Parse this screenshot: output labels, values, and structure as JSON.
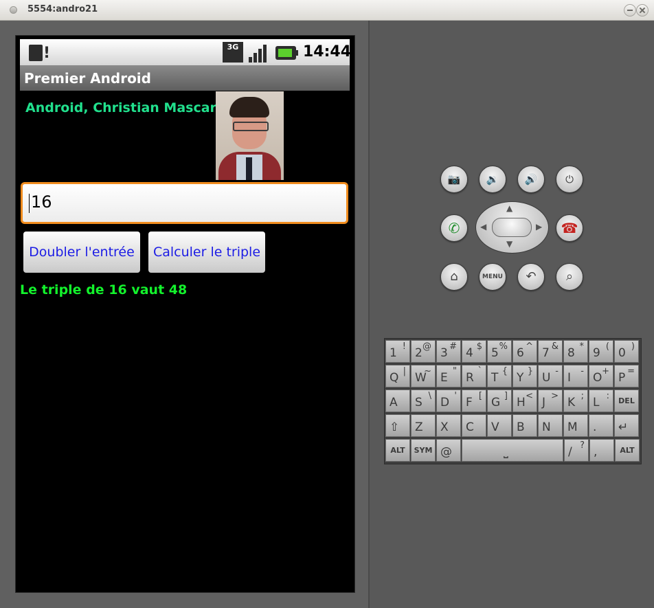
{
  "window": {
    "title": "5554:andro21"
  },
  "status_bar": {
    "time": "14:44",
    "network": "3G"
  },
  "app": {
    "title": "Premier Android",
    "author_label": "Android, Christian Mascart",
    "input_value": "16",
    "button_double": "Doubler l'entrée",
    "button_triple": "Calculer le triple",
    "result_text": "Le triple de 16 vaut 48"
  },
  "controls": {
    "menu_label": "MENU"
  },
  "keyboard": {
    "rows": [
      [
        {
          "m": "1",
          "s": "!"
        },
        {
          "m": "2",
          "s": "@"
        },
        {
          "m": "3",
          "s": "#"
        },
        {
          "m": "4",
          "s": "$"
        },
        {
          "m": "5",
          "s": "%"
        },
        {
          "m": "6",
          "s": "^"
        },
        {
          "m": "7",
          "s": "&"
        },
        {
          "m": "8",
          "s": "*"
        },
        {
          "m": "9",
          "s": "("
        },
        {
          "m": "0",
          "s": ")"
        }
      ],
      [
        {
          "m": "Q",
          "s": "|"
        },
        {
          "m": "W",
          "s": "~"
        },
        {
          "m": "E",
          "s": "\""
        },
        {
          "m": "R",
          "s": "`"
        },
        {
          "m": "T",
          "s": "{"
        },
        {
          "m": "Y",
          "s": "}"
        },
        {
          "m": "U",
          "s": "-"
        },
        {
          "m": "I",
          "s": "-"
        },
        {
          "m": "O",
          "s": "+"
        },
        {
          "m": "P",
          "s": "="
        }
      ],
      [
        {
          "m": "A",
          "s": ""
        },
        {
          "m": "S",
          "s": "\\"
        },
        {
          "m": "D",
          "s": "'"
        },
        {
          "m": "F",
          "s": "["
        },
        {
          "m": "G",
          "s": "]"
        },
        {
          "m": "H",
          "s": "<"
        },
        {
          "m": "J",
          "s": ">"
        },
        {
          "m": "K",
          "s": ";"
        },
        {
          "m": "L",
          "s": ":"
        },
        {
          "m": "DEL",
          "s": ""
        }
      ],
      [
        {
          "m": "⇧",
          "s": ""
        },
        {
          "m": "Z",
          "s": ""
        },
        {
          "m": "X",
          "s": ""
        },
        {
          "m": "C",
          "s": ""
        },
        {
          "m": "V",
          "s": ""
        },
        {
          "m": "B",
          "s": ""
        },
        {
          "m": "N",
          "s": ""
        },
        {
          "m": "M",
          "s": ""
        },
        {
          "m": ".",
          "s": ""
        },
        {
          "m": "↵",
          "s": ""
        }
      ]
    ],
    "bottom": {
      "alt_left": "ALT",
      "sym": "SYM",
      "at": "@",
      "space": "⎵",
      "slash": "/",
      "slash_shift": "?",
      "comma": ",",
      "alt_right": "ALT"
    }
  },
  "colors": {
    "author": "#21e08d",
    "result": "#13f22c",
    "button_text": "#1c1ce5",
    "focus_border": "#f08c1e"
  }
}
